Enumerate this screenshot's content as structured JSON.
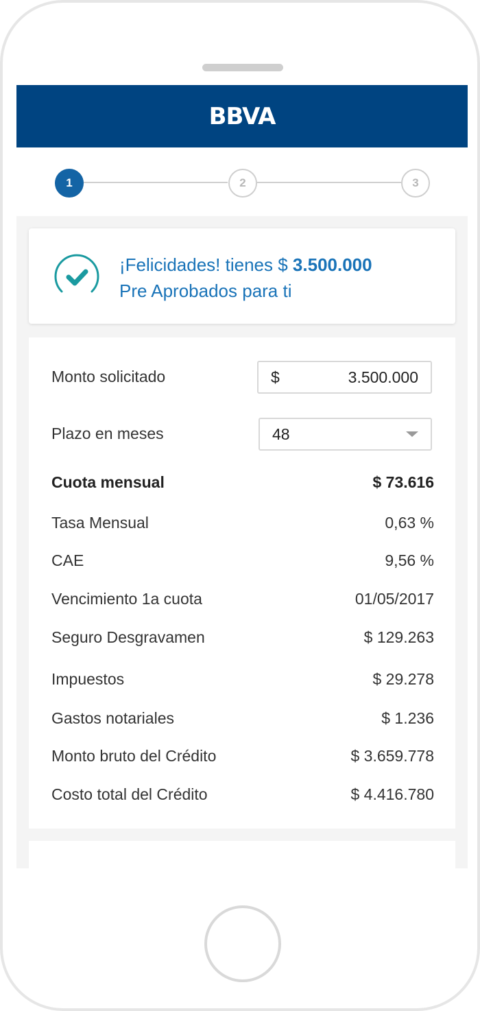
{
  "app": {
    "logo": "BBVA"
  },
  "stepper": {
    "steps": [
      "1",
      "2",
      "3"
    ],
    "active_step": 1
  },
  "approval": {
    "message_prefix": "¡Felicidades! tienes $",
    "amount": "3.500.000",
    "message_line2": "Pre Aprobados para ti",
    "icon": "check-circle-icon"
  },
  "form": {
    "amount_label": "Monto solicitado",
    "amount_currency": "$",
    "amount_value": "3.500.000",
    "term_label": "Plazo en meses",
    "term_value": "48"
  },
  "summary": [
    {
      "label": "Cuota mensual",
      "value": "$ 73.616",
      "bold": true
    },
    {
      "label": "Tasa Mensual",
      "value": "0,63 %"
    },
    {
      "label": "CAE",
      "value": "9,56 %"
    },
    {
      "label": "Vencimiento 1a cuota",
      "value": "01/05/2017"
    },
    {
      "label": "Seguro Desgravamen",
      "value": "$ 129.263"
    },
    {
      "label": "Impuestos",
      "value": "$ 29.278"
    },
    {
      "label": "Gastos notariales",
      "value": "$ 1.236"
    },
    {
      "label": "Monto bruto del Crédito",
      "value": "$ 3.659.778"
    },
    {
      "label": "Costo total del Crédito",
      "value": "$ 4.416.780"
    }
  ],
  "colors": {
    "brand": "#004481",
    "accent": "#1973b8",
    "success": "#1a9aa0"
  }
}
